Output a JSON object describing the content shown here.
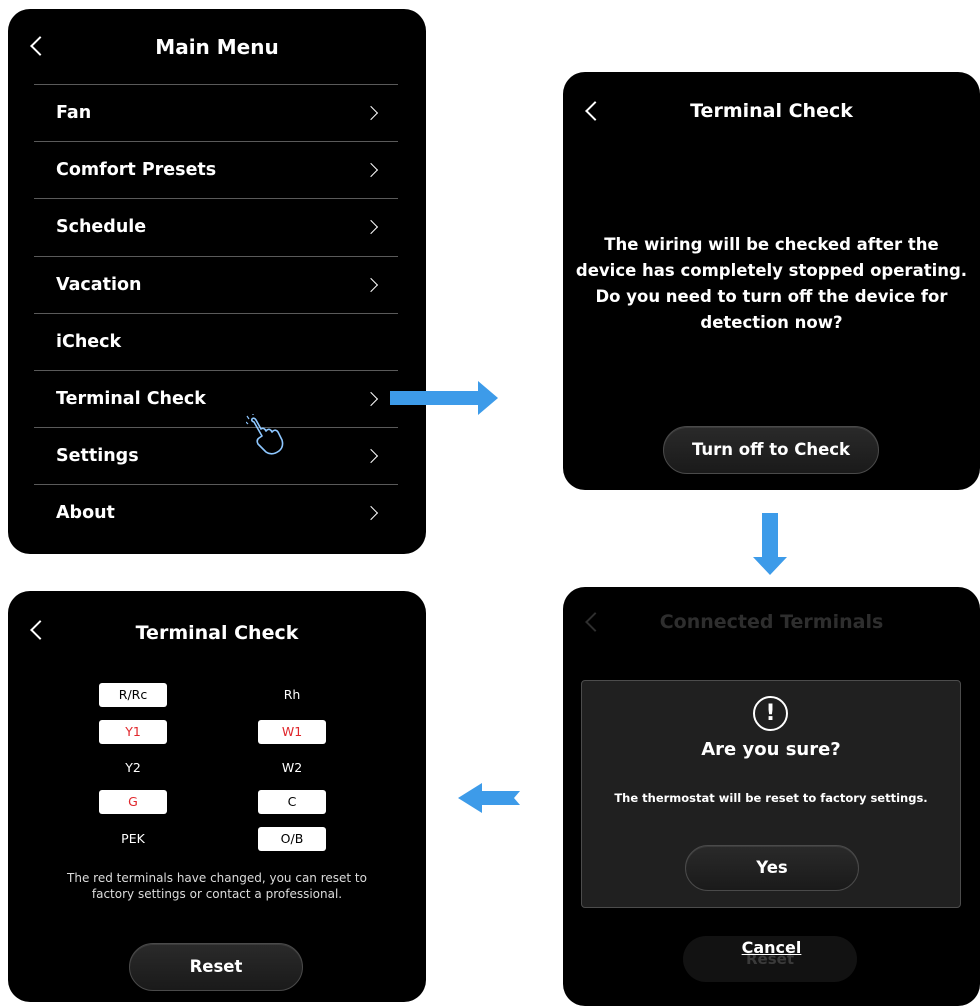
{
  "main_menu": {
    "title": "Main Menu",
    "items": [
      {
        "label": "Fan",
        "chevron": true
      },
      {
        "label": "Comfort Presets",
        "chevron": true
      },
      {
        "label": "Schedule",
        "chevron": true
      },
      {
        "label": "Vacation",
        "chevron": true
      },
      {
        "label": "iCheck",
        "chevron": false
      },
      {
        "label": "Terminal Check",
        "chevron": true
      },
      {
        "label": "Settings",
        "chevron": true
      },
      {
        "label": "About",
        "chevron": true
      }
    ]
  },
  "terminal_prompt": {
    "title": "Terminal Check",
    "message_lines": [
      "The wiring will be checked after the",
      "device has completely stopped operating.",
      "Do you need to turn off the device for",
      "detection now?"
    ],
    "button": "Turn off to Check"
  },
  "confirm": {
    "bg_title": "Connected Terminals",
    "heading": "Are you sure?",
    "message": "The thermostat will be reset to factory settings.",
    "yes": "Yes",
    "cancel": "Cancel",
    "bg_button": "Reset"
  },
  "terminal_result": {
    "title": "Terminal Check",
    "terminals": [
      {
        "label": "R/Rc",
        "style": "box",
        "color": "#000000"
      },
      {
        "label": "Rh",
        "style": "plain",
        "color": "#ffffff"
      },
      {
        "label": "Y1",
        "style": "box",
        "color": "#e0262b"
      },
      {
        "label": "W1",
        "style": "box",
        "color": "#e0262b"
      },
      {
        "label": "Y2",
        "style": "plain",
        "color": "#ffffff"
      },
      {
        "label": "W2",
        "style": "plain",
        "color": "#ffffff"
      },
      {
        "label": "G",
        "style": "box",
        "color": "#e0262b"
      },
      {
        "label": "C",
        "style": "box",
        "color": "#000000"
      },
      {
        "label": "PEK",
        "style": "plain",
        "color": "#ffffff"
      },
      {
        "label": "O/B",
        "style": "box",
        "color": "#000000"
      }
    ],
    "note_lines": [
      "The red terminals have changed, you can reset to",
      "factory settings or contact a professional."
    ],
    "button": "Reset"
  },
  "colors": {
    "arrow": "#3d9be9",
    "changed_terminal": "#e0262b"
  }
}
